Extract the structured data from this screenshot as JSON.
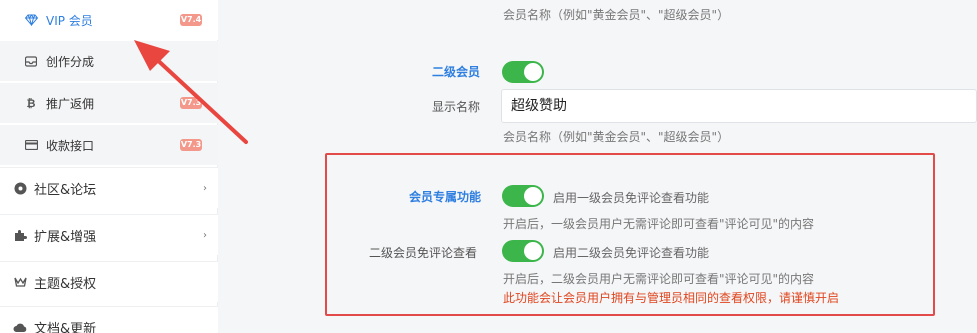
{
  "sidebar": {
    "sub_items": [
      {
        "label": "VIP 会员",
        "icon": "diamond-icon",
        "badge": "V7.4",
        "active": true
      },
      {
        "label": "创作分成",
        "icon": "inbox-icon",
        "badge": ""
      },
      {
        "label": "推广返佣",
        "icon": "bitcoin-icon",
        "badge": "V7.3"
      },
      {
        "label": "收款接口",
        "icon": "credit-card-icon",
        "badge": "V7.3"
      }
    ],
    "main_items": [
      {
        "label": "社区&论坛",
        "icon": "community-icon",
        "chevron": "›"
      },
      {
        "label": "扩展&增强",
        "icon": "puzzle-icon",
        "chevron": "›"
      },
      {
        "label": "主题&授权",
        "icon": "theme-icon",
        "chevron": ""
      },
      {
        "label": "文档&更新",
        "icon": "cloud-icon",
        "chevron": ""
      }
    ]
  },
  "content": {
    "hint_top": "会员名称（例如\"黄金会员\"、\"超级会员\"）",
    "level2_label": "二级会员",
    "level2_enabled": true,
    "display_name_label": "显示名称",
    "display_name_value": "超级赞助",
    "hint_mid": "会员名称（例如\"黄金会员\"、\"超级会员\"）",
    "exclusive_label": "会员专属功能",
    "exclusive_toggle_text": "启用一级会员免评论查看功能",
    "exclusive_hint": "开启后，一级会员用户无需评论即可查看\"评论可见\"的内容",
    "level2_comment_label": "二级会员免评论查看",
    "level2_comment_toggle_text": "启用二级会员免评论查看功能",
    "level2_comment_hint": "开启后，二级会员用户无需评论即可查看\"评论可见\"的内容",
    "warning": "此功能会让会员用户拥有与管理员相同的查看权限，请谨慎开启"
  },
  "colors": {
    "accent": "#2f7fe0",
    "toggle_on": "#3cb54a",
    "highlight": "#e34a4a",
    "warning": "#e0461f",
    "badge": "#f3988a"
  }
}
